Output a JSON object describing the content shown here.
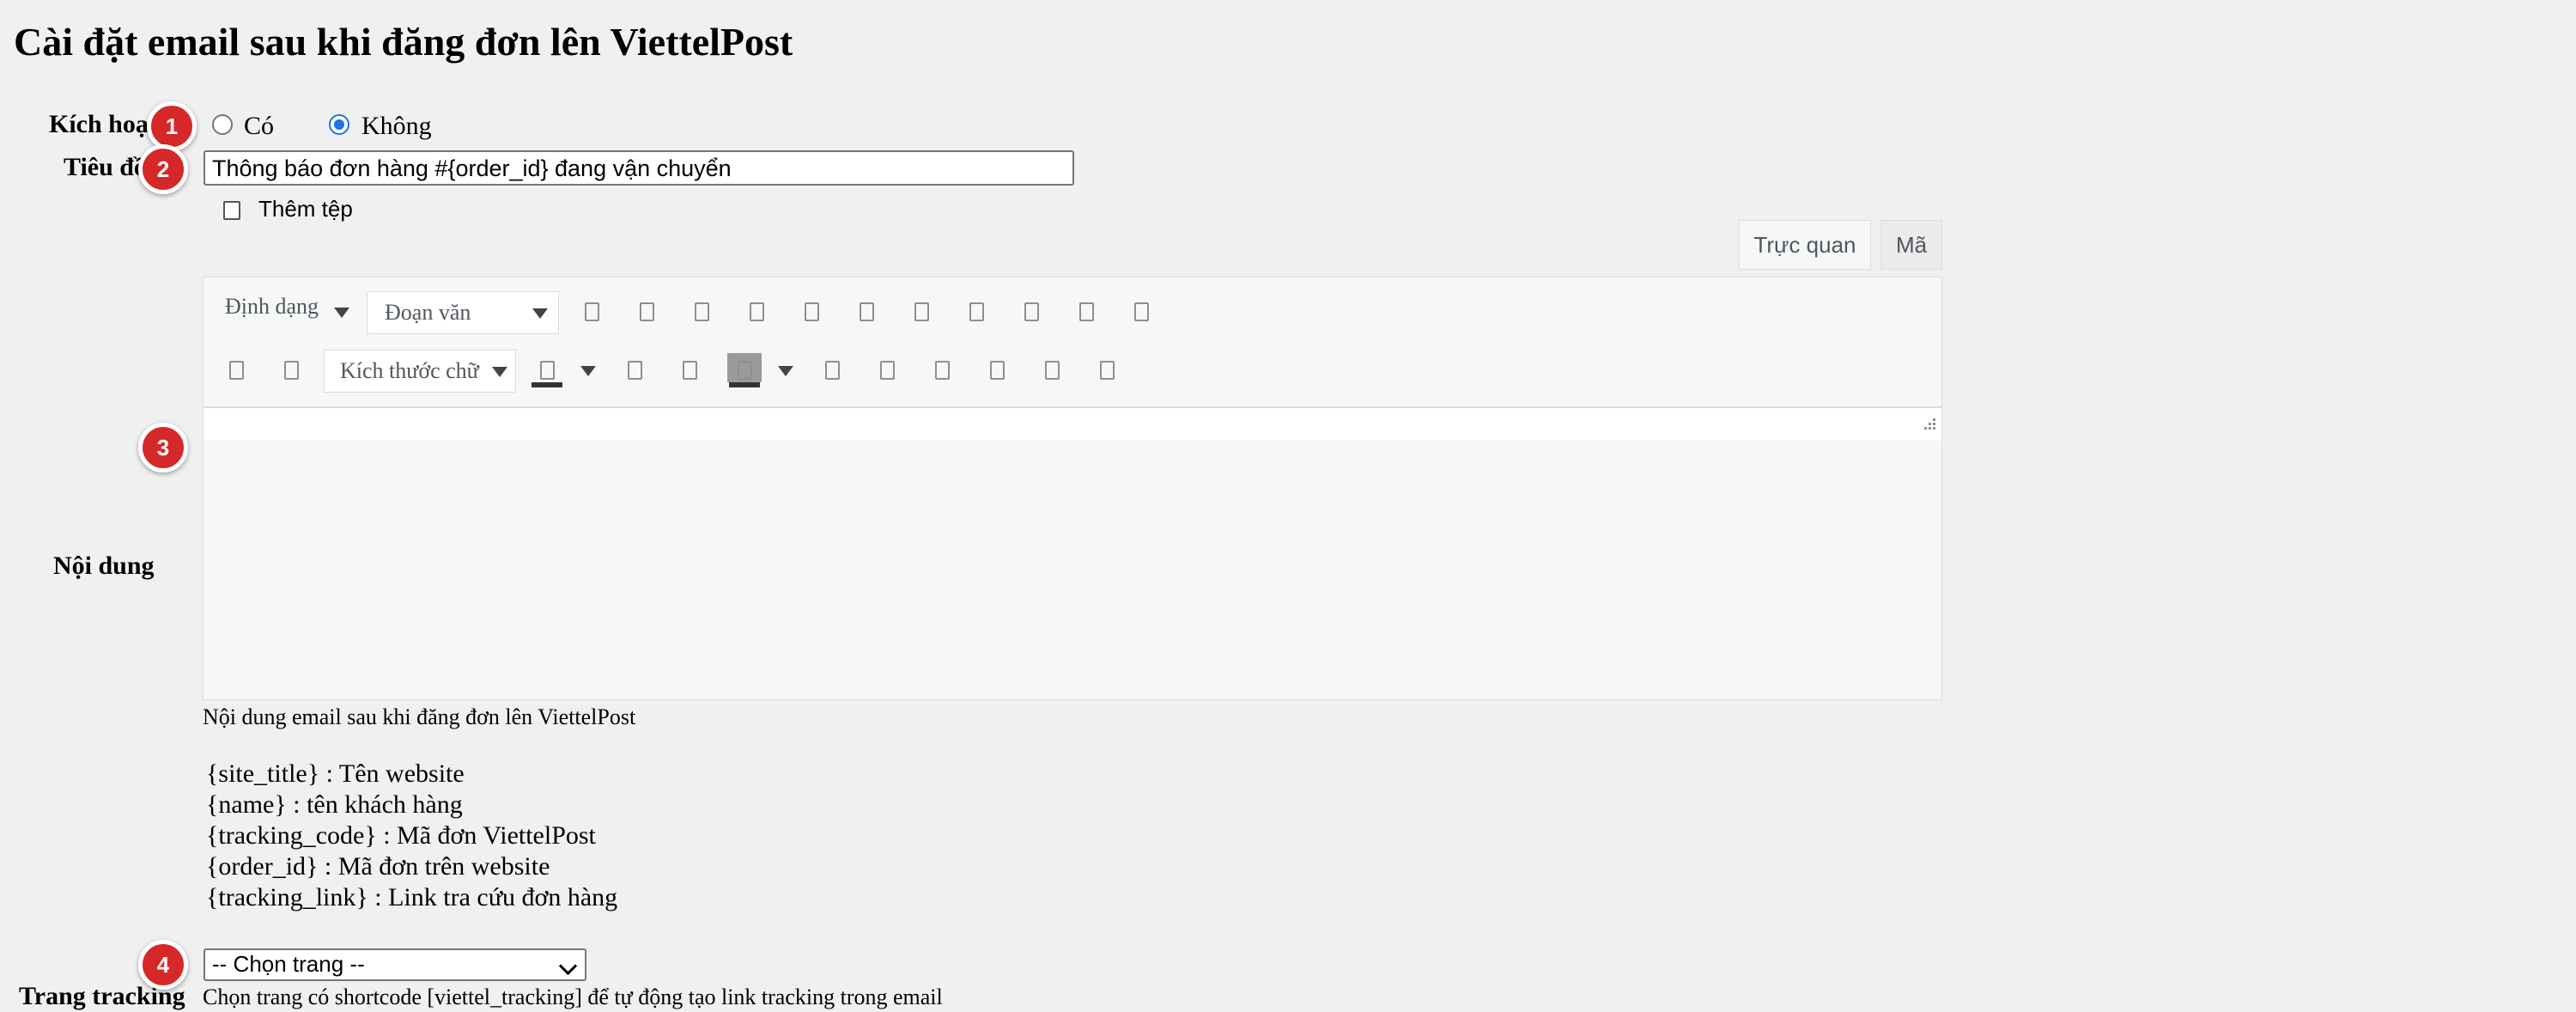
{
  "page": {
    "title": "Cài đặt email sau khi đăng đơn lên ViettelPost"
  },
  "fields": {
    "activate": {
      "label": "Kích hoạt",
      "options": [
        "Có",
        "Không"
      ],
      "selected": "Không"
    },
    "subject": {
      "label": "Tiêu đề",
      "value": "Thông báo đơn hàng #{order_id} đang vận chuyển"
    },
    "content": {
      "label": "Nội dung"
    },
    "tracking": {
      "label": "Trang tracking"
    }
  },
  "editor": {
    "add_file": "Thêm tệp",
    "tabs": {
      "visual": "Trực quan",
      "code": "Mã"
    },
    "toolbar": {
      "format_menu": "Định dạng",
      "paragraph": "Đoạn văn",
      "font_size": "Kích thước chữ"
    },
    "description": "Nội dung email sau khi đăng đơn lên ViettelPost"
  },
  "shortcodes": [
    "{site_title} : Tên website",
    "{name} : tên khách hàng",
    "{tracking_code} : Mã đơn ViettelPost",
    "{order_id} : Mã đơn trên website",
    "{tracking_link} : Link tra cứu đơn hàng"
  ],
  "tracking_page": {
    "selected": "-- Chọn trang --",
    "description": "Chọn trang có shortcode [viettel_tracking] để tự động tạo link tracking trong email"
  },
  "badges": [
    "1",
    "2",
    "3",
    "4"
  ],
  "colors": {
    "badge": "#d62828",
    "radio_checked": "#1a73e8",
    "page_background": "#f0f0f0"
  }
}
